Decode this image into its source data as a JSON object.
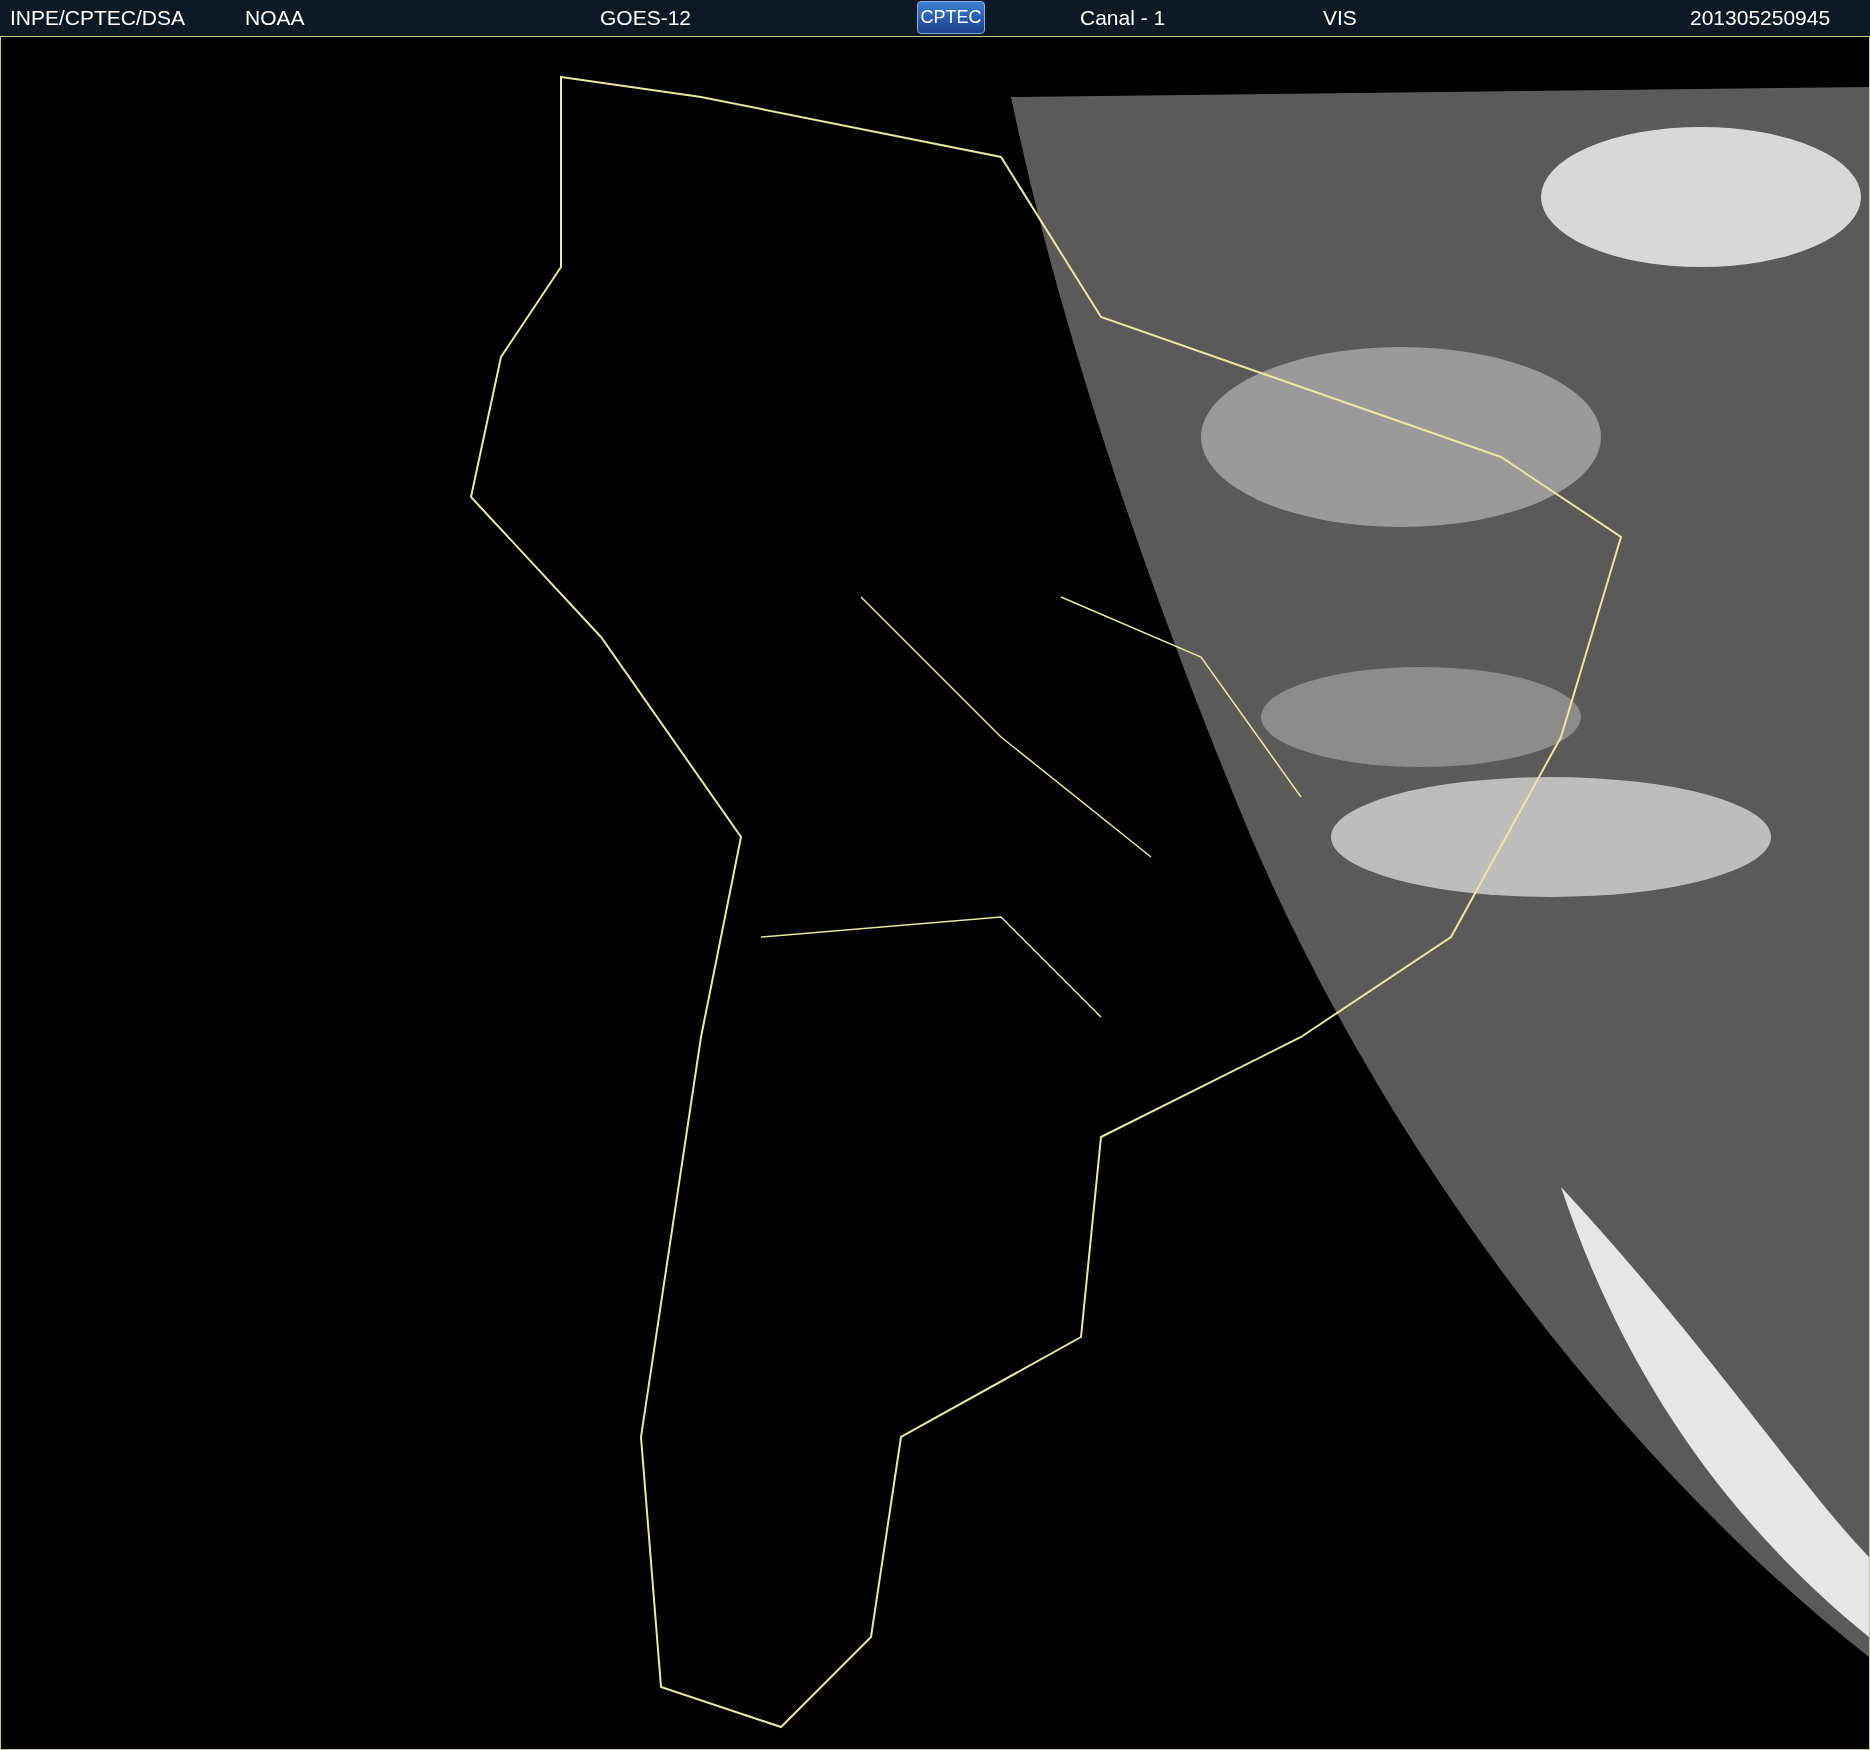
{
  "header": {
    "items": [
      {
        "kind": "text",
        "text": "INPE/CPTEC/DSA"
      },
      {
        "kind": "text",
        "text": "NOAA"
      },
      {
        "kind": "text",
        "text": "GOES-12"
      },
      {
        "kind": "logo",
        "text": "CPTEC"
      },
      {
        "kind": "text",
        "text": "Canal - 1"
      },
      {
        "kind": "text",
        "text": "VIS"
      },
      {
        "kind": "text",
        "text": "201305250945"
      }
    ]
  }
}
